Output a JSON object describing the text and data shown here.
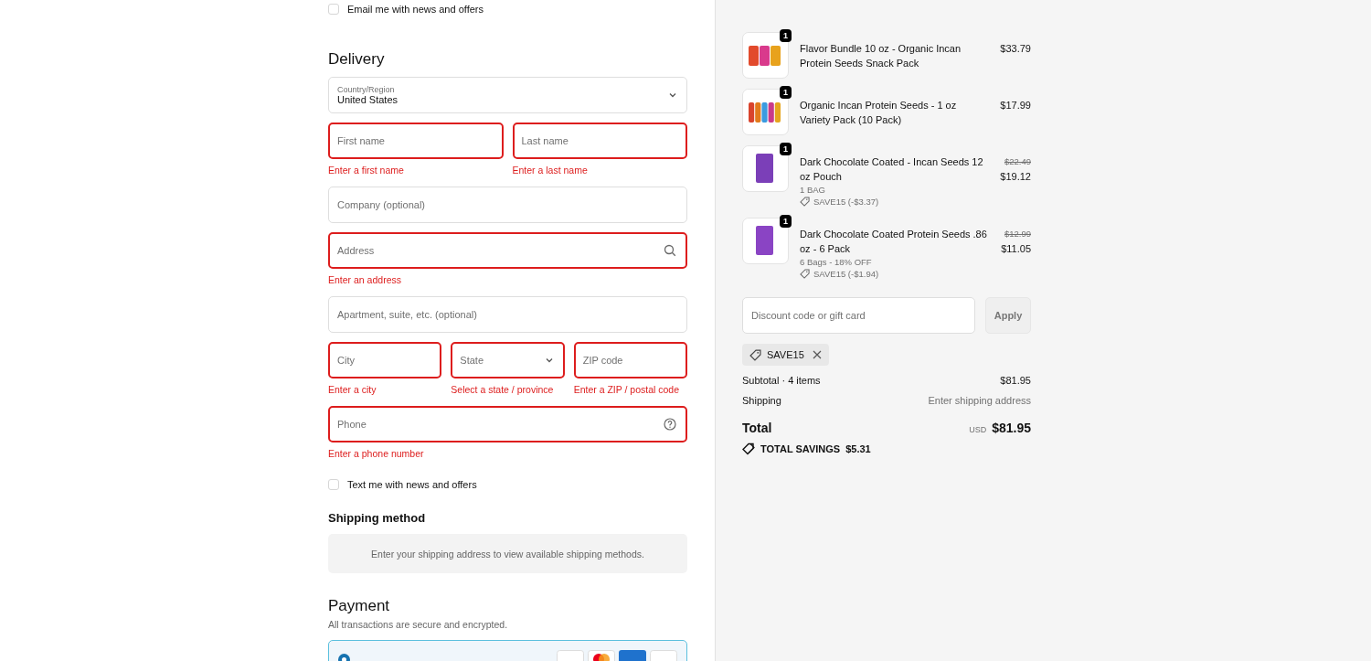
{
  "marketing_email": {
    "label": "Email me with news and offers",
    "checked": false
  },
  "delivery": {
    "heading": "Delivery",
    "country": {
      "label": "Country/Region",
      "value": "United States"
    },
    "rows": [
      [
        {
          "kind": "text",
          "placeholder": "First name",
          "error": "Enter a first name"
        },
        {
          "kind": "text",
          "placeholder": "Last name",
          "error": "Enter a last name"
        }
      ],
      [
        {
          "kind": "text",
          "placeholder": "Company (optional)"
        }
      ],
      [
        {
          "kind": "search",
          "placeholder": "Address",
          "error": "Enter an address"
        }
      ],
      [
        {
          "kind": "text",
          "placeholder": "Apartment, suite, etc. (optional)"
        }
      ],
      [
        {
          "kind": "text",
          "placeholder": "City",
          "error": "Enter a city"
        },
        {
          "kind": "select",
          "placeholder": "State",
          "error": "Select a state / province"
        },
        {
          "kind": "text",
          "placeholder": "ZIP code",
          "error": "Enter a ZIP / postal code"
        }
      ],
      [
        {
          "kind": "help",
          "placeholder": "Phone",
          "error": "Enter a phone number"
        }
      ]
    ]
  },
  "marketing_sms": {
    "label": "Text me with news and offers",
    "checked": false
  },
  "shipping_method": {
    "heading": "Shipping method",
    "notice": "Enter your shipping address to view available shipping methods."
  },
  "payment": {
    "heading": "Payment",
    "subtitle": "All transactions are secure and encrypted.",
    "methods": [
      {
        "selected": true
      }
    ]
  },
  "cart": {
    "items": [
      {
        "title": "Flavor Bundle 10 oz - Organic Incan Protein Seeds Snack Pack",
        "quantity": "1",
        "price": "$33.79"
      },
      {
        "title": "Organic Incan Protein Seeds - 1 oz Variety Pack (10 Pack)",
        "quantity": "1",
        "price": "$17.99"
      },
      {
        "title": "Dark Chocolate Coated - Incan Seeds 12 oz Pouch",
        "quantity": "1",
        "compare_price": "$22.49",
        "price": "$19.12",
        "variant": "1 BAG",
        "discount": "SAVE15 (-$3.37)"
      },
      {
        "title": "Dark Chocolate Coated Protein Seeds .86 oz - 6 Pack",
        "quantity": "1",
        "compare_price": "$12.99",
        "price": "$11.05",
        "variant": "6 Bags - 18% OFF",
        "discount": "SAVE15 (-$1.94)"
      }
    ],
    "discount_field": {
      "placeholder": "Discount code or gift card",
      "button": "Apply"
    },
    "applied_codes": [
      {
        "code": "SAVE15"
      }
    ],
    "summary": [
      {
        "label": "Subtotal · 4 items",
        "value": "$81.95",
        "muted": false
      },
      {
        "label": "Shipping",
        "value": "Enter shipping address",
        "muted": true
      }
    ],
    "total": {
      "label": "Total",
      "currency": "USD",
      "amount": "$81.95"
    },
    "savings": {
      "label": "TOTAL SAVINGS",
      "amount": "$5.31"
    }
  }
}
